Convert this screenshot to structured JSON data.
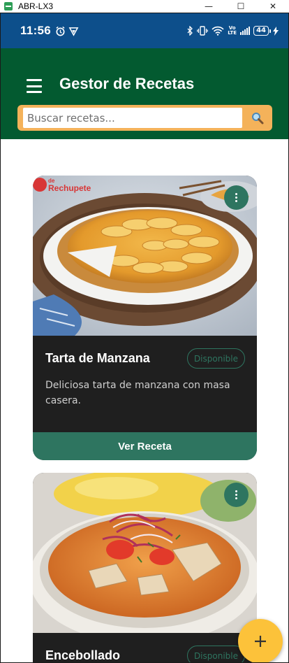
{
  "window": {
    "title": "ABR-LX3",
    "minimize_glyph": "—",
    "maximize_glyph": "☐",
    "close_glyph": "✕"
  },
  "status_bar": {
    "time": "11:56",
    "network_label_top": "Vo",
    "network_label_bottom": "LTE",
    "battery_level": "44",
    "icons": [
      "alarm-icon",
      "vpn-icon",
      "bluetooth-icon",
      "vibrate-icon",
      "wifi-icon",
      "signal-icon",
      "battery-icon",
      "charging-icon"
    ]
  },
  "app_bar": {
    "title": "Gestor de Recetas",
    "search_placeholder": "Buscar recetas...",
    "search_value": ""
  },
  "recipes": [
    {
      "title": "Tarta de Manzana",
      "status": "Disponible",
      "description": "Deliciosa tarta de manzana con masa casera.",
      "action_label": "Ver Receta",
      "image_brand_small": "de",
      "image_brand": "Rechupete"
    },
    {
      "title": "Encebollado",
      "status": "Disponible"
    }
  ],
  "fab": {
    "icon": "add-icon",
    "glyph": "+"
  },
  "colors": {
    "status_bar": "#0d4f8b",
    "app_bar": "#035a30",
    "search_border": "#f4b25a",
    "card_bg": "#1f1f1f",
    "accent_green": "#2e7560",
    "fab": "#fcc23a"
  }
}
